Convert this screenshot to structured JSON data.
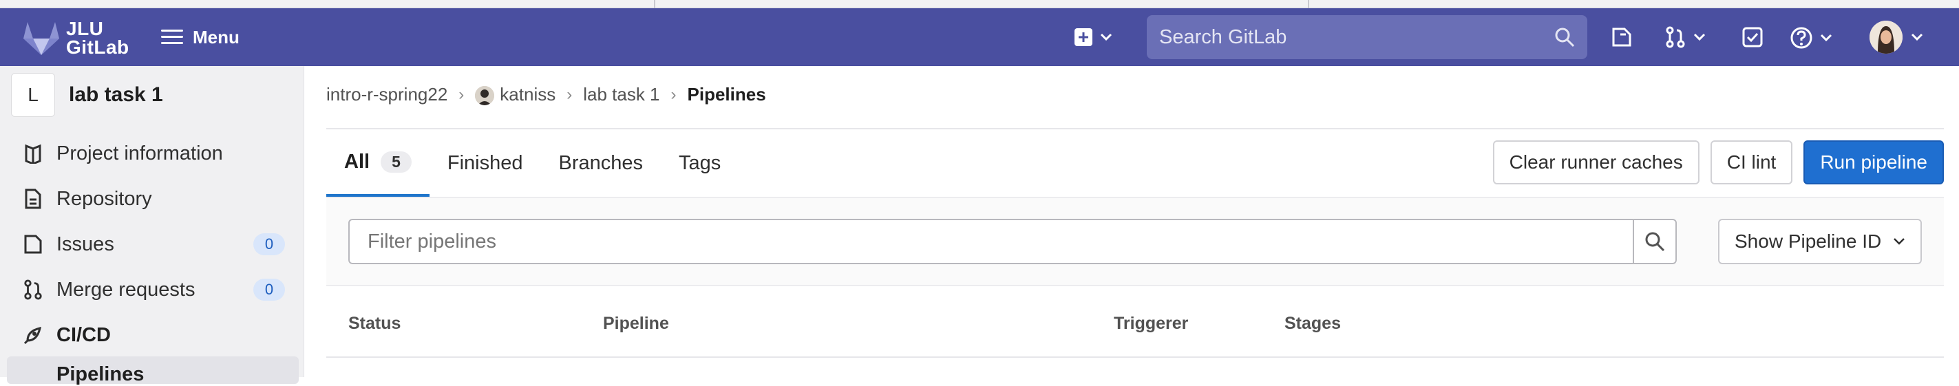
{
  "colors": {
    "topbar": "#4a4fa0",
    "primary_button": "#1f6fd0",
    "active_tab": "#1f75cb",
    "badge": "#d9e6fb"
  },
  "brand": {
    "line1": "JLU",
    "line2": "GitLab"
  },
  "topbar": {
    "menu_label": "Menu",
    "search_placeholder": "Search GitLab"
  },
  "sidebar": {
    "project_initial": "L",
    "project_name": "lab task 1",
    "items": [
      {
        "label": "Project information",
        "icon": "book-icon"
      },
      {
        "label": "Repository",
        "icon": "document-icon"
      },
      {
        "label": "Issues",
        "icon": "issues-icon",
        "count": "0"
      },
      {
        "label": "Merge requests",
        "icon": "merge-request-icon",
        "count": "0"
      },
      {
        "label": "CI/CD",
        "icon": "rocket-icon"
      }
    ],
    "sub_item": "Pipelines"
  },
  "breadcrumb": {
    "group": "intro-r-spring22",
    "user": "katniss",
    "project": "lab task 1",
    "current": "Pipelines"
  },
  "tabs": [
    {
      "label": "All",
      "count": "5"
    },
    {
      "label": "Finished"
    },
    {
      "label": "Branches"
    },
    {
      "label": "Tags"
    }
  ],
  "actions": {
    "clear_caches": "Clear runner caches",
    "ci_lint": "CI lint",
    "run_pipeline": "Run pipeline"
  },
  "filter": {
    "placeholder": "Filter pipelines",
    "show_id": "Show Pipeline ID"
  },
  "table": {
    "columns": [
      "Status",
      "Pipeline",
      "Triggerer",
      "Stages"
    ]
  }
}
